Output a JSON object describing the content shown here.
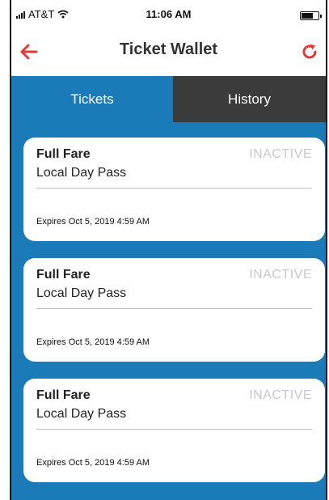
{
  "status_bar": {
    "carrier": "AT&T",
    "time": "11:06 AM",
    "icons": [
      "signal-icon",
      "wifi-icon",
      "battery-icon"
    ]
  },
  "navbar": {
    "title": "Ticket Wallet",
    "back_icon": "back-arrow-icon",
    "refresh_icon": "refresh-icon"
  },
  "tabs": [
    {
      "label": "Tickets",
      "active": true
    },
    {
      "label": "History",
      "active": false
    }
  ],
  "tickets": [
    {
      "fare": "Full Fare",
      "status": "INACTIVE",
      "pass": "Local Day Pass",
      "expires": "Expires Oct 5, 2019 4:59 AM"
    },
    {
      "fare": "Full Fare",
      "status": "INACTIVE",
      "pass": "Local Day Pass",
      "expires": "Expires Oct 5, 2019 4:59 AM"
    },
    {
      "fare": "Full Fare",
      "status": "INACTIVE",
      "pass": "Local Day Pass",
      "expires": "Expires Oct 5, 2019 4:59 AM"
    }
  ],
  "colors": {
    "accent": "#e53935",
    "tab_active_bg": "#1a7bb8",
    "tab_inactive_bg": "#3b3b3b",
    "inactive_text": "#c9c9c9"
  }
}
